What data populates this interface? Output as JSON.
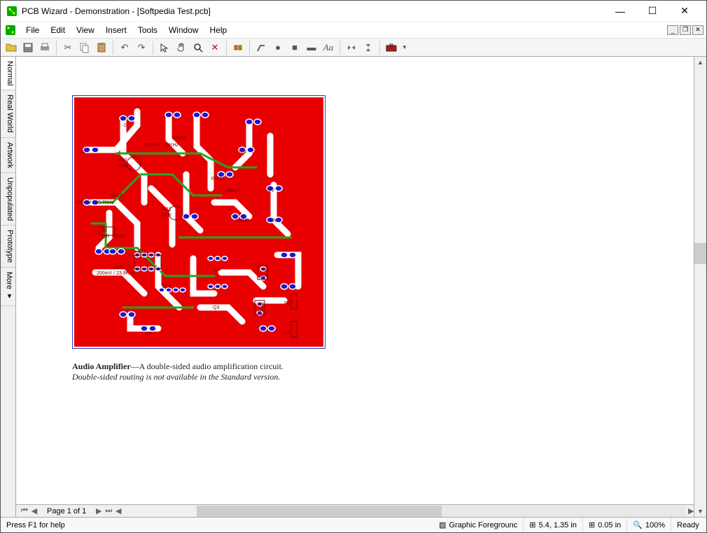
{
  "title_bar": {
    "text": "PCB Wizard - Demonstration - [Softpedia Test.pcb]"
  },
  "menu": {
    "items": [
      "File",
      "Edit",
      "View",
      "Insert",
      "Tools",
      "Window",
      "Help"
    ]
  },
  "side_tabs": [
    "Normal",
    "Real World",
    "Artwork",
    "Unpopulated",
    "Prototype",
    "More ▾"
  ],
  "caption": {
    "title": "Audio Amplifier",
    "desc": "—A double-sided audio amplification circuit.",
    "note": "Double-sided routing is not available in the Standard version."
  },
  "hscroll": {
    "page": "Page 1 of 1"
  },
  "status": {
    "help": "Press F1 for help",
    "layer": "Graphic Foregrounc",
    "coords": "5.4, 1.35 in",
    "grid": "0.05 in",
    "zoom": "100%",
    "ready": "Ready"
  },
  "pcb_labels": {
    "l1": "-1V",
    "l2": "XSG3",
    "l3": "200mV / 10KHz",
    "l4": "1V",
    "l5": "VR2",
    "l6": "100K",
    "l7": "-5V",
    "l8": "XMM1",
    "l9": "XSG2",
    "l10": "300mV / 16.7KHz",
    "l11": "XMM3",
    "l12": "-9V",
    "l13": "VR1",
    "l14": "100K",
    "l15": "XMM2",
    "l16": "9V",
    "l17": "R9",
    "l18": "10K",
    "l19": "SW2",
    "l20": "IC1",
    "l21": "XSG1",
    "l22": "200mV / 23.9KHz",
    "l23": "Q4",
    "l24": "R8",
    "l25": "10K",
    "l26": "SC1",
    "l27": "Q3",
    "l28": "R7",
    "l29": "1K",
    "l30": "D3",
    "l31": "9V",
    "l32": "D4"
  }
}
